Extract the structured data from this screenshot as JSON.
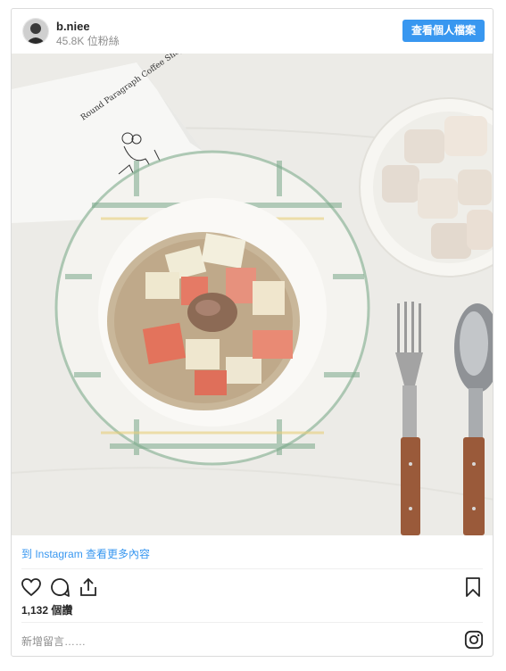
{
  "header": {
    "username": "b.niee",
    "followers": "45.8K 位粉絲",
    "view_profile_label": "查看個人檔案"
  },
  "photo": {
    "napkin_text": "Round Paragraph Coffee Shop"
  },
  "footer": {
    "more_link": "到 Instagram 查看更多內容",
    "likes": "1,132 個讚",
    "comment_placeholder": "新增留言……"
  },
  "icons": {
    "like": "heart-icon",
    "comment": "comment-icon",
    "share": "share-icon",
    "save": "bookmark-icon",
    "brand": "instagram-icon"
  },
  "colors": {
    "accent": "#3897f0",
    "text": "#262626",
    "muted": "#8e8e8e",
    "border": "#dbdbdb"
  }
}
